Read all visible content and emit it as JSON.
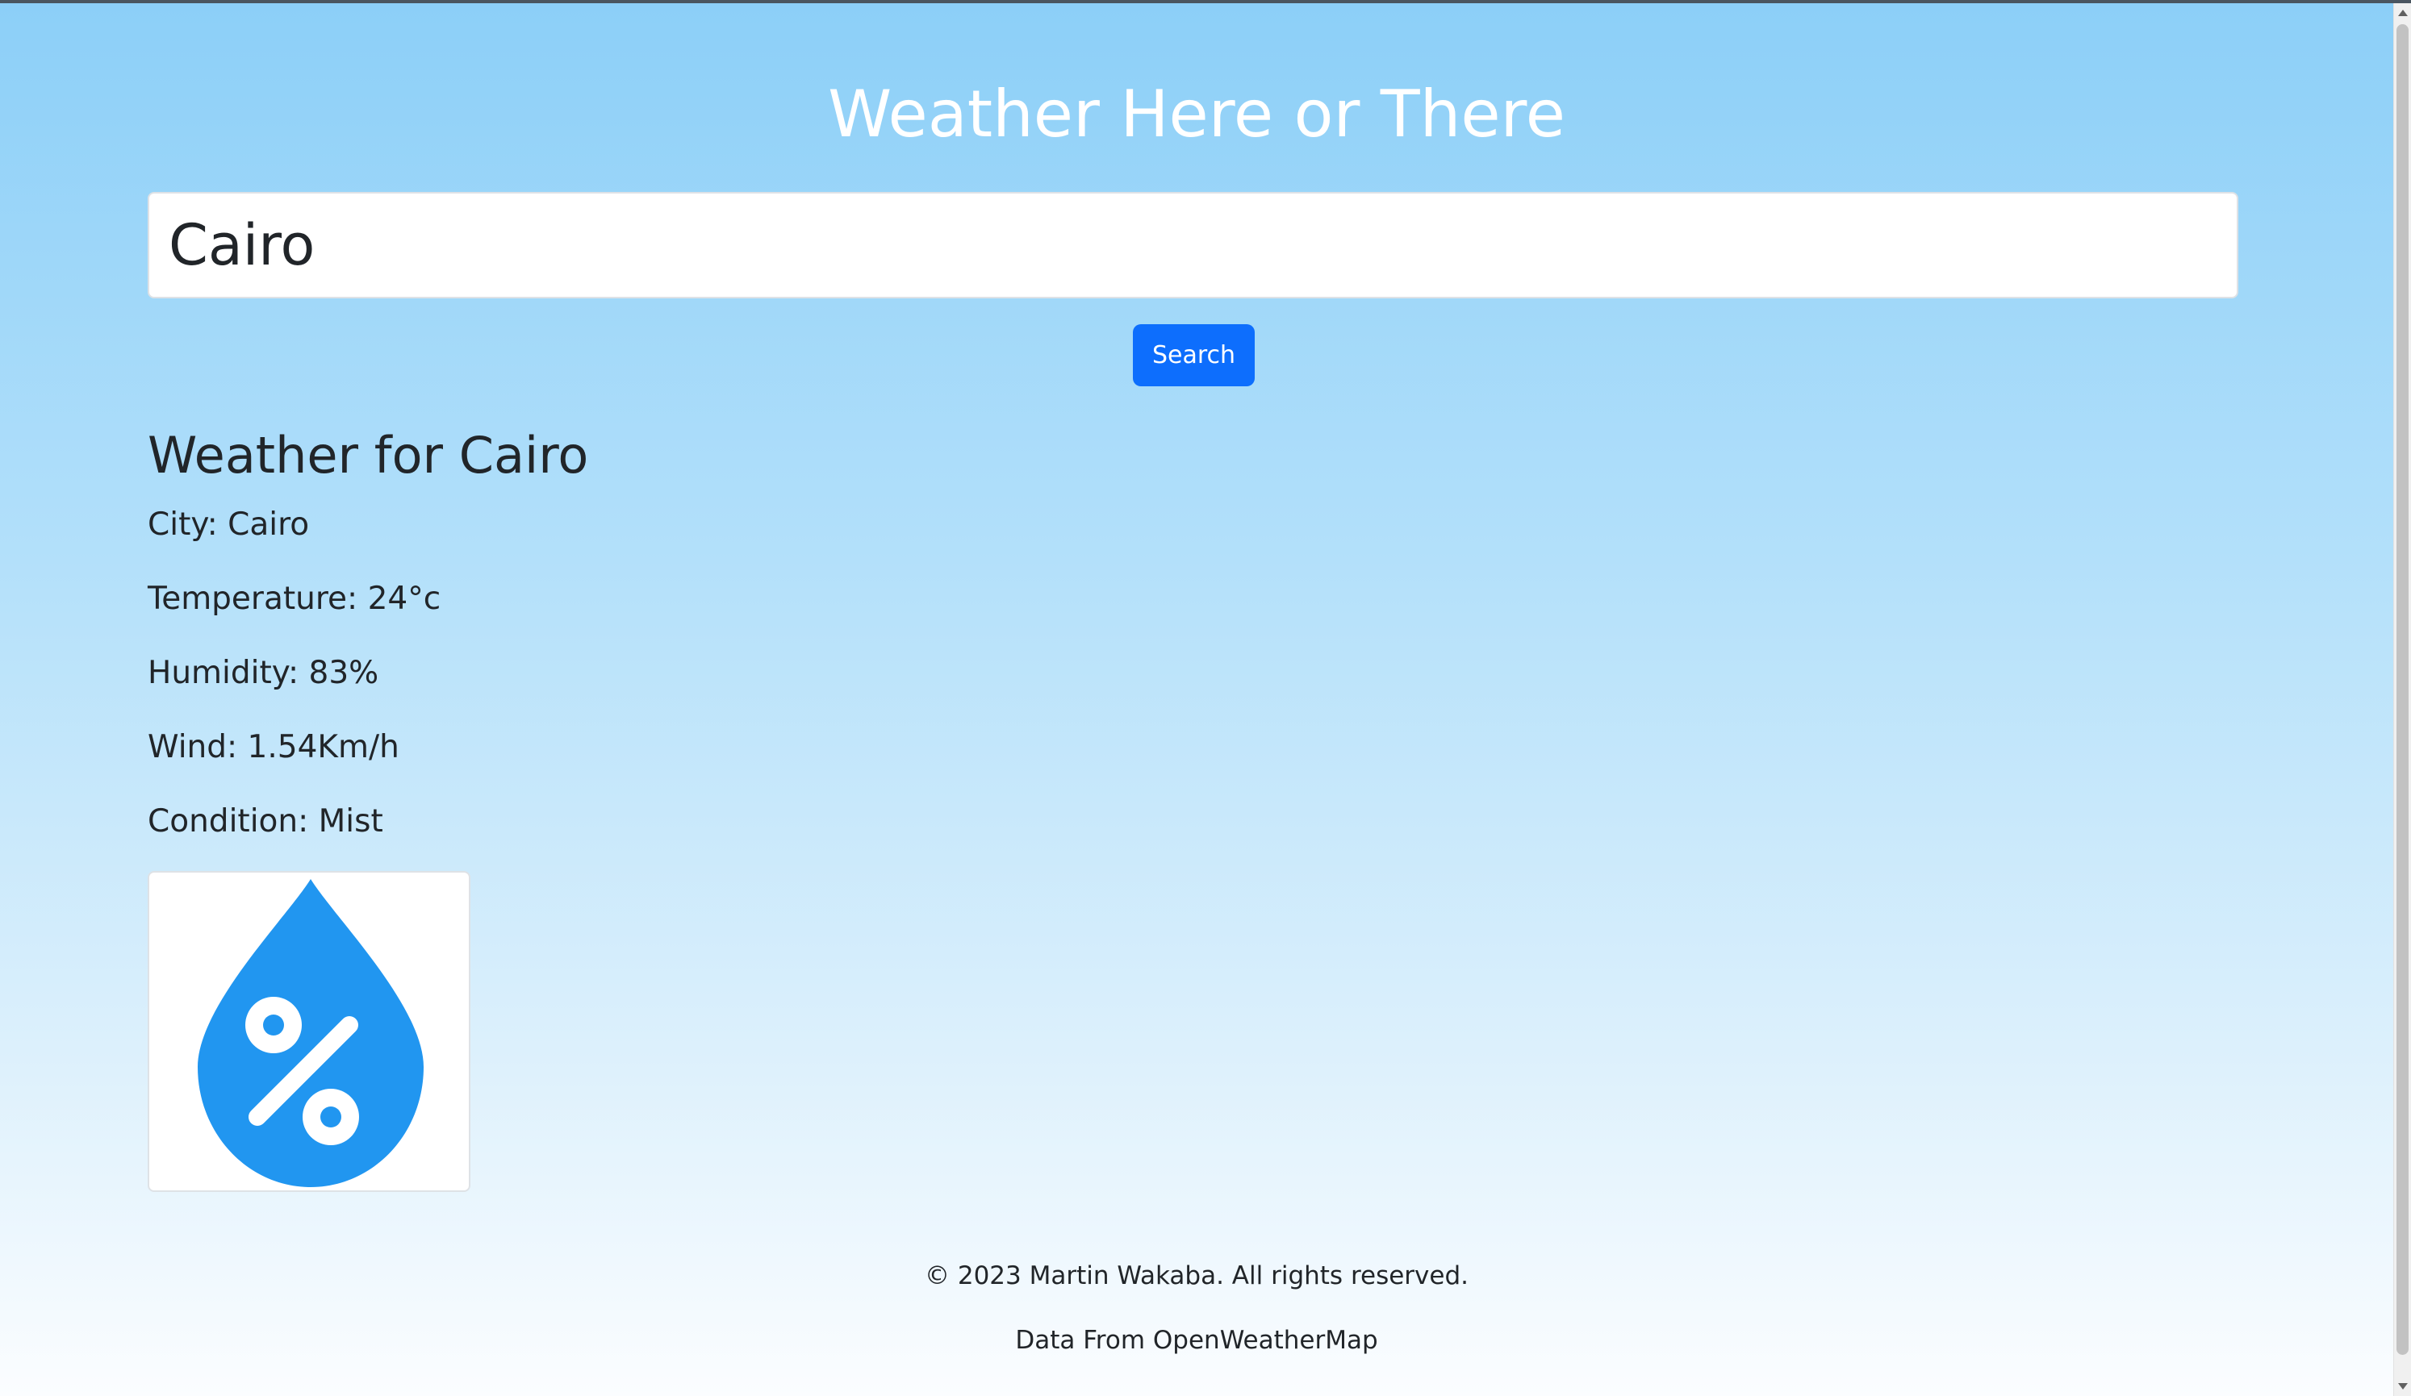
{
  "header": {
    "title": "Weather Here or There"
  },
  "search": {
    "value": "Cairo",
    "button_label": "Search"
  },
  "weather": {
    "heading": "Weather for Cairo",
    "city_line": "City: Cairo",
    "temperature_line": "Temperature: 24°c",
    "humidity_line": "Humidity: 83%",
    "wind_line": "Wind: 1.54Km/h",
    "condition_line": "Condition: Mist",
    "icon": "humidity-drop-icon"
  },
  "footer": {
    "copyright": "© 2023 Martin Wakaba. All rights reserved.",
    "data_source": "Data From OpenWeatherMap"
  },
  "colors": {
    "accent": "#0d6efd",
    "icon_blue": "#2196f0",
    "title_text": "#ffffff",
    "body_text": "#212529"
  }
}
